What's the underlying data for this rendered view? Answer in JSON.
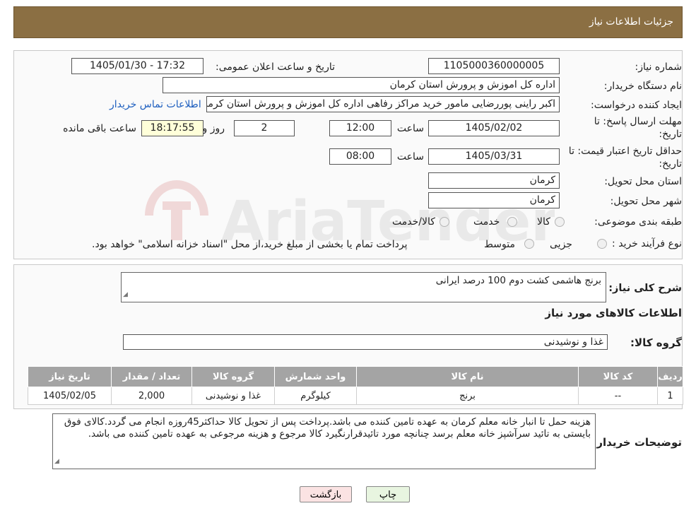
{
  "header": {
    "title": "جزئیات اطلاعات نیاز"
  },
  "form": {
    "need_number_label": "شماره نیاز:",
    "need_number": "1105000360000005",
    "announce_label": "تاریخ و ساعت اعلان عمومی:",
    "announce_value": "1405/01/30 - 17:32",
    "buyer_org_label": "نام دستگاه خریدار:",
    "buyer_org": "اداره کل اموزش و پرورش استان کرمان",
    "creator_label": "ایجاد کننده درخواست:",
    "creator": "اکبر راینی پوررضایی مامور خرید مراکز رفاهی اداره کل اموزش و پرورش استان کرمان",
    "contact_link": "اطلاعات تماس خریدار",
    "deadline_label_line1": "مهلت ارسال پاسخ: تا",
    "deadline_label_line2": "تاریخ:",
    "deadline_date": "1405/02/02",
    "time_label": "ساعت",
    "deadline_time": "12:00",
    "days_value": "2",
    "days_label": "روز و",
    "remaining_time": "18:17:55",
    "remaining_label": "ساعت باقی مانده",
    "validity_label_line1": "حداقل تاریخ اعتبار قیمت: تا",
    "validity_label_line2": "تاریخ:",
    "validity_date": "1405/03/31",
    "validity_time_label": "ساعت",
    "validity_time": "08:00",
    "province_label": "استان محل تحویل:",
    "province": "کرمان",
    "city_label": "شهر محل تحویل:",
    "city": "کرمان",
    "category_label": "طبقه بندی موضوعی:",
    "category_options": [
      "کالا",
      "خدمت",
      "کالا/خدمت"
    ],
    "process_label": "نوع فرآیند خرید :",
    "process_options": [
      "جزیی",
      "متوسط"
    ],
    "process_note": "پرداخت تمام یا بخشی از مبلغ خرید،از محل \"اسناد خزانه اسلامی\" خواهد بود."
  },
  "watermark": {
    "text": "AriaTender.neT"
  },
  "summary": {
    "label": "شرح کلی نیاز:",
    "text": "برنج هاشمی کشت دوم 100 درصد ایرانی",
    "goods_info_title": "اطلاعات کالاهای مورد نیاز",
    "group_label": "گروه کالا:",
    "group_value": "غذا و نوشیدنی"
  },
  "table": {
    "headers": [
      "ردیف",
      "کد کالا",
      "نام کالا",
      "واحد شمارش",
      "گروه کالا",
      "تعداد / مقدار",
      "تاریخ نیاز"
    ],
    "rows": [
      [
        "1",
        "--",
        "برنج",
        "کیلوگرم",
        "غذا و نوشیدنی",
        "2,000",
        "1405/02/05"
      ]
    ]
  },
  "buyer_notes": {
    "label": "توضیحات خریدار:",
    "text": "هزینه حمل تا انبار خانه معلم کرمان به عهده تامین کننده می باشد.پرداخت پس از تحویل کالا حداکثر45روزه انجام می گردد.کالای فوق بایستی به تائید سرآشپز خانه معلم برسد چنانچه مورد تائیدقرارنگیرد کالا مرجوع و هزینه مرجوعی به عهده تامین کننده می باشد."
  },
  "buttons": {
    "print": "چاپ",
    "back": "بازگشت"
  },
  "colors": {
    "header_bg": "#8b6f43",
    "print_bg": "#e8f5e0",
    "back_bg": "#fbe3e3",
    "link": "#1e5fbf",
    "table_header_bg": "#a4a4a4"
  }
}
